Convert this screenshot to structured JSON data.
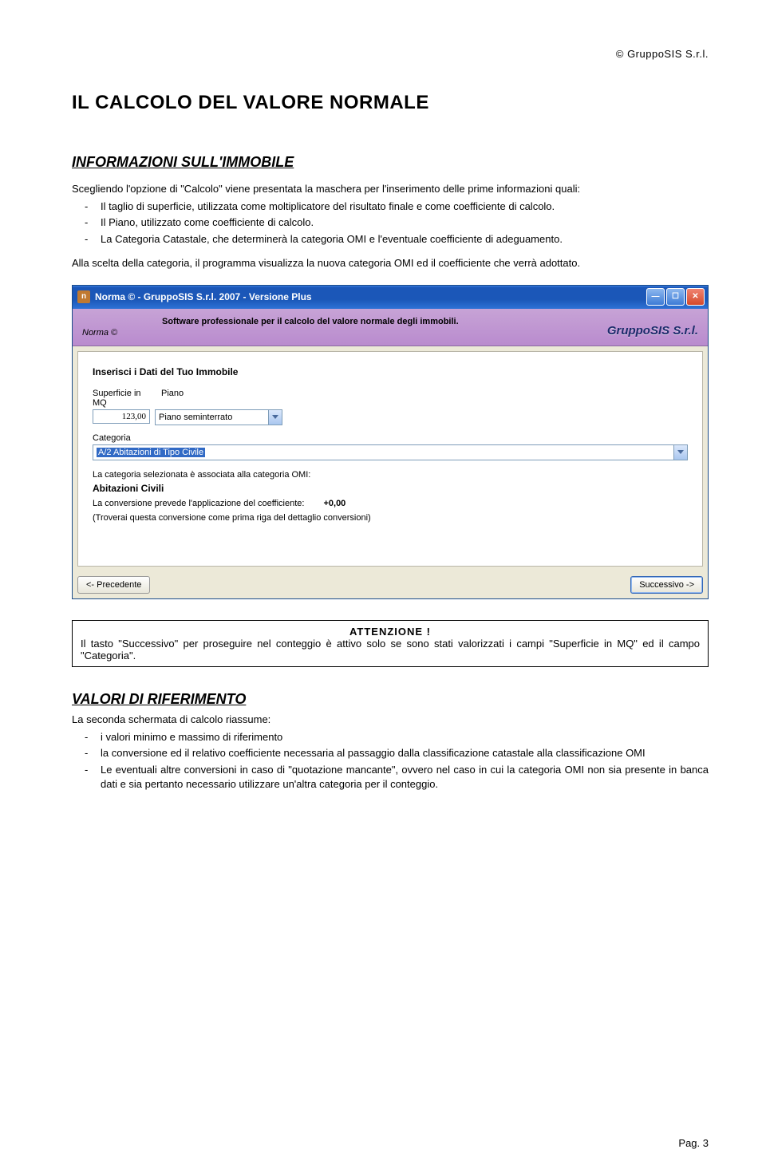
{
  "header_right": "© GruppoSIS S.r.l.",
  "main_title": "IL CALCOLO DEL VALORE NORMALE",
  "section1": {
    "title": "INFORMAZIONI SULL'IMMOBILE",
    "intro": "Scegliendo l'opzione di \"Calcolo\" viene presentata la maschera per l'inserimento delle prime informazioni quali:",
    "bullets": [
      "Il taglio di superficie, utilizzata come moltiplicatore del risultato finale e come coefficiente di calcolo.",
      "Il Piano, utilizzato come coefficiente di calcolo.",
      "La Categoria Catastale, che determinerà la categoria OMI e l'eventuale coefficiente di adeguamento."
    ],
    "after": "Alla scelta della categoria, il programma visualizza la nuova categoria OMI ed il coefficiente che verrà adottato."
  },
  "window": {
    "title": "Norma © - GruppoSIS S.r.l. 2007 - Versione Plus",
    "banner_norma": "Norma ©",
    "banner_sub": "Software professionale per il calcolo del valore normale degli immobili.",
    "banner_brand": "GruppoSIS S.r.l.",
    "form_heading": "Inserisci i Dati del Tuo Immobile",
    "lbl_superficie": "Superficie in MQ",
    "lbl_piano": "Piano",
    "val_superficie": "123,00",
    "val_piano": "Piano seminterrato",
    "lbl_categoria": "Categoria",
    "val_categoria": "A/2 Abitazioni di Tipo Civile",
    "assoc_line": "La categoria selezionata è associata alla categoria OMI:",
    "assoc_value": "Abitazioni Civili",
    "coef_line": "La conversione prevede l'applicazione del coefficiente:",
    "coef_value": "+0,00",
    "note_line": "(Troverai questa conversione come prima riga del dettaglio conversioni)",
    "btn_prev": "<- Precedente",
    "btn_next": "Successivo ->"
  },
  "attention": {
    "title": "ATTENZIONE !",
    "text": "Il tasto \"Successivo\" per proseguire nel conteggio è attivo solo se sono stati valorizzati i campi \"Superficie in MQ\" ed il campo \"Categoria\"."
  },
  "section2": {
    "title": "VALORI DI RIFERIMENTO",
    "intro": "La seconda schermata di calcolo riassume:",
    "bullets": [
      "i valori minimo e massimo di riferimento",
      "la conversione ed il relativo coefficiente necessaria al passaggio dalla classificazione catastale alla classificazione OMI",
      "Le eventuali altre conversioni in caso di \"quotazione mancante\", ovvero nel caso in cui la categoria OMI non sia presente in banca dati e sia pertanto necessario utilizzare un'altra categoria per il conteggio."
    ]
  },
  "page_num": "Pag. 3"
}
